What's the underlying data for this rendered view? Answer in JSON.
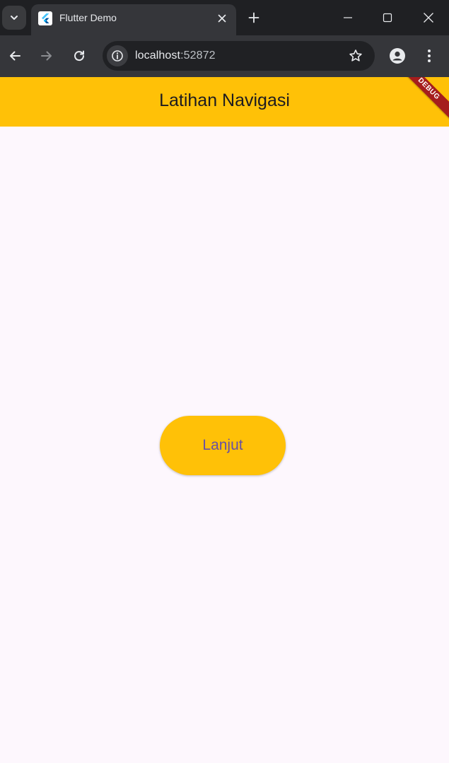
{
  "browser": {
    "tab": {
      "title": "Flutter Demo",
      "favicon": "flutter-logo-icon"
    },
    "address_bar": {
      "host": "localhost",
      "port": ":52872"
    },
    "colors": {
      "tabstrip": "#1f2023",
      "toolbar": "#35363a",
      "omnibox": "#202124"
    }
  },
  "app": {
    "appbar": {
      "title": "Latihan Navigasi",
      "color": "#ffc107"
    },
    "debug_banner": "DEBUG",
    "button": {
      "label": "Lanjut",
      "color": "#ffc107",
      "text_color": "#6750a4"
    },
    "background": "#fdf7fd"
  }
}
